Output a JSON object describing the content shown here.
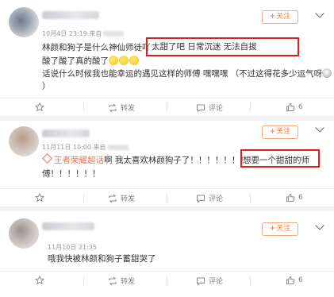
{
  "posts": [
    {
      "time": "10月4日 23:19 来自",
      "follow_label": "关注",
      "lines": [
        "林颜和狗子是什么神仙师徒吖",
        "酸了酸了真的酸了",
        "话说什么时候我也能幸运的遇见这样的师傅  嘿嘿嘿  （不过这得花多少运气呀",
        "）"
      ],
      "highlight": "太甜了吧  日常沉迷  无法自拔",
      "actions": {
        "fav": "",
        "repost": "转发",
        "comment": "评论",
        "like": "6"
      }
    },
    {
      "time": "11月11日 10:00 来自",
      "follow_label": "关注",
      "topic": "王者荣耀超话",
      "line1": "啊 我太喜欢林颜狗子了！！！！！！！",
      "highlight": "想要一个甜甜的师",
      "line2": "傅！！！！！！",
      "actions": {
        "fav": "",
        "repost": "转发",
        "comment": "评论",
        "like": "6"
      }
    },
    {
      "time": "11月10日 21:35",
      "follow_label": "关注",
      "line1": "哦我快被林颜和狗子蓄甜哭了",
      "actions": {
        "fav": "",
        "repost": "转发",
        "comment": "评论",
        "like": "6"
      }
    }
  ],
  "colors": {
    "accent": "#ff8140",
    "highlight_box": "#d8221f",
    "topic": "#eb7350"
  }
}
